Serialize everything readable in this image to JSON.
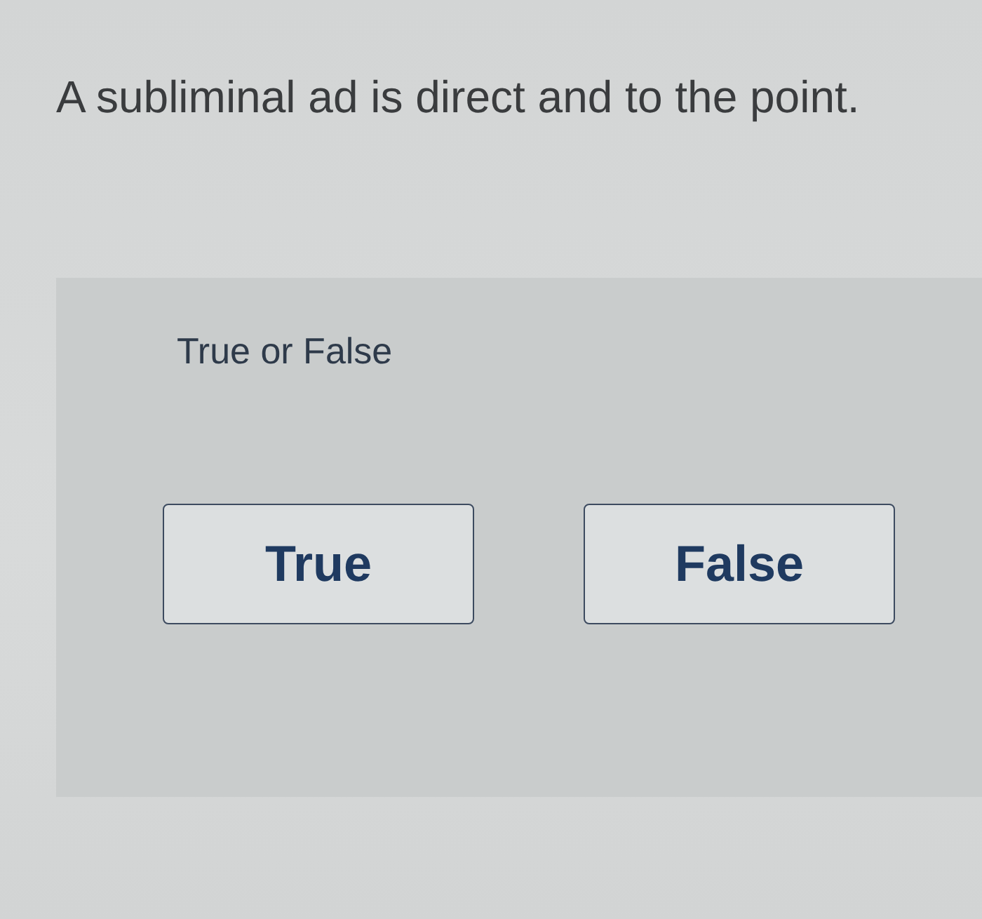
{
  "question": {
    "text": "A subliminal ad is direct and to the point."
  },
  "answer_panel": {
    "label": "True or False",
    "options": [
      {
        "label": "True"
      },
      {
        "label": "False"
      }
    ]
  }
}
